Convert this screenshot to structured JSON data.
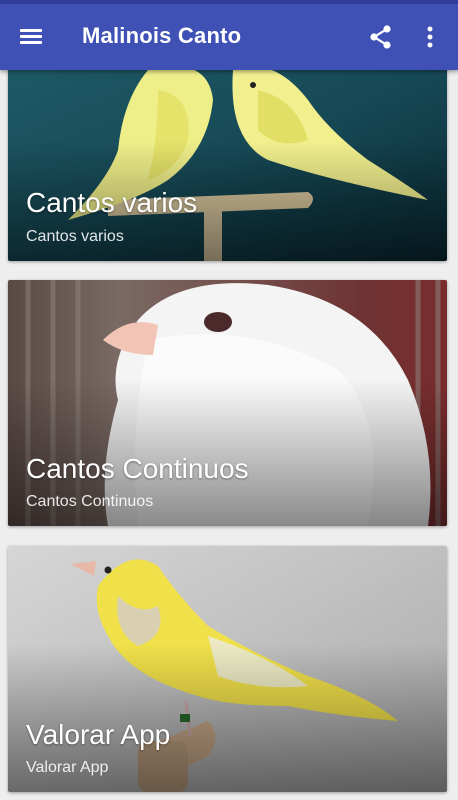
{
  "app": {
    "title": "Malinois Canto"
  },
  "toolbar": {
    "menu_icon": "hamburger-menu-icon",
    "share_icon": "share-icon",
    "more_icon": "more-vert-icon",
    "bar_color": "#3f51b5"
  },
  "cards": [
    {
      "title": "Cantos varios",
      "subtitle": "Cantos varios"
    },
    {
      "title": "Cantos Continuos",
      "subtitle": "Cantos Continuos"
    },
    {
      "title": "Valorar App",
      "subtitle": "Valorar App"
    }
  ]
}
